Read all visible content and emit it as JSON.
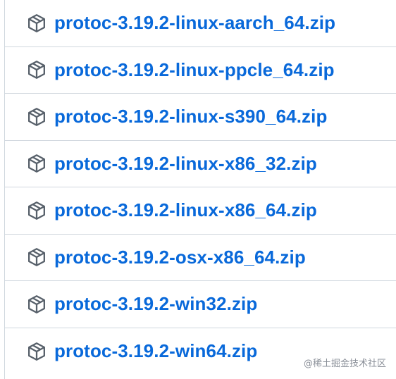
{
  "assets": [
    {
      "name": "protoc-3.19.2-linux-aarch_64.zip",
      "icon": "package-icon"
    },
    {
      "name": "protoc-3.19.2-linux-ppcle_64.zip",
      "icon": "package-icon"
    },
    {
      "name": "protoc-3.19.2-linux-s390_64.zip",
      "icon": "package-icon"
    },
    {
      "name": "protoc-3.19.2-linux-x86_32.zip",
      "icon": "package-icon"
    },
    {
      "name": "protoc-3.19.2-linux-x86_64.zip",
      "icon": "package-icon"
    },
    {
      "name": "protoc-3.19.2-osx-x86_64.zip",
      "icon": "package-icon"
    },
    {
      "name": "protoc-3.19.2-win32.zip",
      "icon": "package-icon"
    },
    {
      "name": "protoc-3.19.2-win64.zip",
      "icon": "package-icon"
    }
  ],
  "watermark": "@稀土掘金技术社区",
  "colors": {
    "link": "#0969da",
    "icon": "#57606a",
    "border": "#d0d7de"
  }
}
